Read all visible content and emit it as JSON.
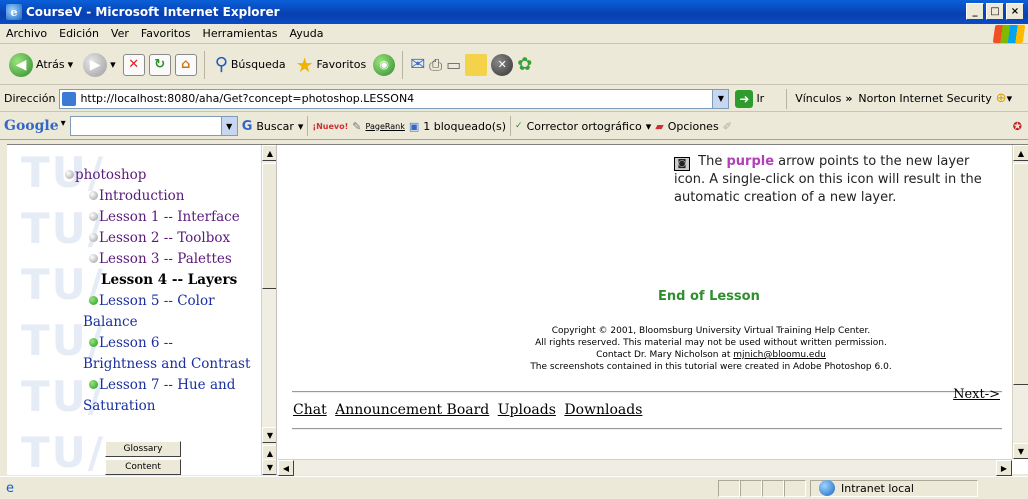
{
  "window": {
    "title": "CourseV - Microsoft Internet Explorer",
    "controls": [
      "_",
      "□",
      "×"
    ]
  },
  "menu": [
    "Archivo",
    "Edición",
    "Ver",
    "Favoritos",
    "Herramientas",
    "Ayuda"
  ],
  "toolbar": {
    "back": "Atrás",
    "search": "Búsqueda",
    "favorites": "Favoritos"
  },
  "address": {
    "label": "Dirección",
    "url": "http://localhost:8080/aha/Get?concept=photoshop.LESSON4",
    "go": "Ir",
    "links": "Vínculos",
    "norton": "Norton Internet Security"
  },
  "google_bar": {
    "logo": "Google",
    "search": "Buscar",
    "new": "¡Nuevo!",
    "pagerank": "PageRank",
    "blocked": "1 bloqueado(s)",
    "spell": "Corrector ortográfico",
    "options": "Opciones"
  },
  "sidebar": {
    "watermark": "TU/",
    "root": "photoshop",
    "items": [
      {
        "label": "Introduction",
        "state": "visited"
      },
      {
        "label": "Lesson 1 -- Interface",
        "state": "visited"
      },
      {
        "label": "Lesson 2 -- Toolbox",
        "state": "visited"
      },
      {
        "label": "Lesson 3 -- Palettes",
        "state": "visited"
      },
      {
        "label": "Lesson 4 -- Layers",
        "state": "current"
      },
      {
        "label": "Lesson 5 -- Color",
        "wrap": "Balance",
        "state": "recommended"
      },
      {
        "label": "Lesson 6 --",
        "wrap": "Brightness and Contrast",
        "state": "recommended"
      },
      {
        "label": "Lesson 7 -- Hue and",
        "wrap": "Saturation",
        "state": "recommended"
      }
    ],
    "buttons": [
      "Glossary",
      "Content"
    ]
  },
  "main": {
    "icon_glyph": "◙",
    "para_pre": "The",
    "para_purple": "purple",
    "para_post": "arrow points to the new layer icon. A single-click on this icon will result in the automatic creation of a new layer.",
    "end_of_lesson": "End of Lesson",
    "copyright_l1": "Copyright © 2001, Bloomsburg University Virtual Training Help Center.",
    "copyright_l2": "All rights reserved. This material may not be used without written permission.",
    "copyright_l3_pre": "Contact Dr. Mary Nicholson at ",
    "copyright_email": "mjnich@bloomu.edu",
    "copyright_l4": "The screenshots contained in this tutorial were created in Adobe Photoshop 6.0.",
    "next": "Next->",
    "links": [
      "Chat",
      "Announcement Board",
      "Uploads",
      "Downloads"
    ]
  },
  "status": {
    "zone": "Intranet local"
  },
  "colors": {
    "visited_link": "#5a1a7a",
    "recommended_link": "#1a2fa0",
    "accent_purple": "#b040b8",
    "end_green": "#2f8f2f"
  }
}
